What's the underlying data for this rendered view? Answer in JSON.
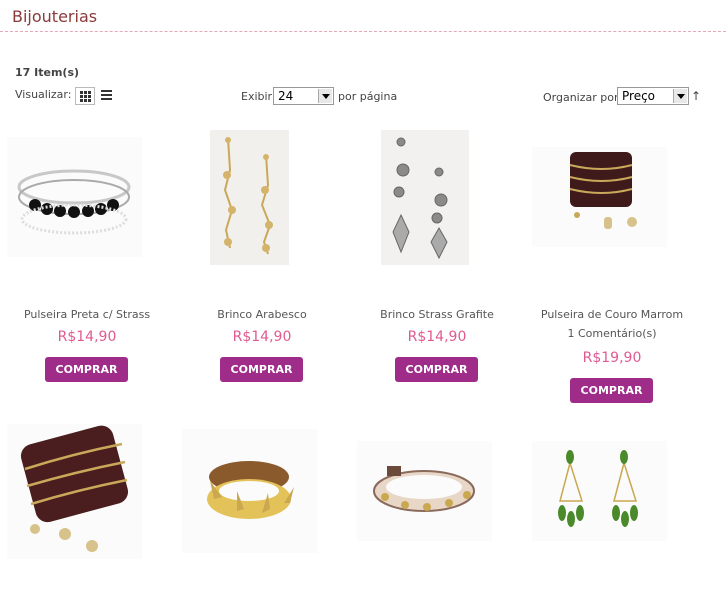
{
  "category": {
    "title": "Bijouterias"
  },
  "toolbar": {
    "item_count": "17 Item(s)",
    "view_label": "Visualizar:",
    "show_label": "Exibir",
    "per_page_value": "24",
    "per_page_suffix": "por página",
    "sort_label": "Organizar por",
    "sort_value": "Preço",
    "sort_direction": "↑"
  },
  "products": [
    {
      "name": "Pulseira Preta c/ Strass",
      "price": "R$14,90",
      "buy_label": "COMPRAR"
    },
    {
      "name": "Brinco Arabesco",
      "price": "R$14,90",
      "buy_label": "COMPRAR"
    },
    {
      "name": "Brinco Strass Grafite",
      "price": "R$14,90",
      "buy_label": "COMPRAR"
    },
    {
      "name": "Pulseira de Couro Marrom",
      "comments": "1 Comentário(s)",
      "price": "R$19,90",
      "buy_label": "COMPRAR"
    }
  ],
  "colors": {
    "accent": "#a02c8a",
    "price": "#e05a91",
    "title": "#8b3a3a"
  }
}
